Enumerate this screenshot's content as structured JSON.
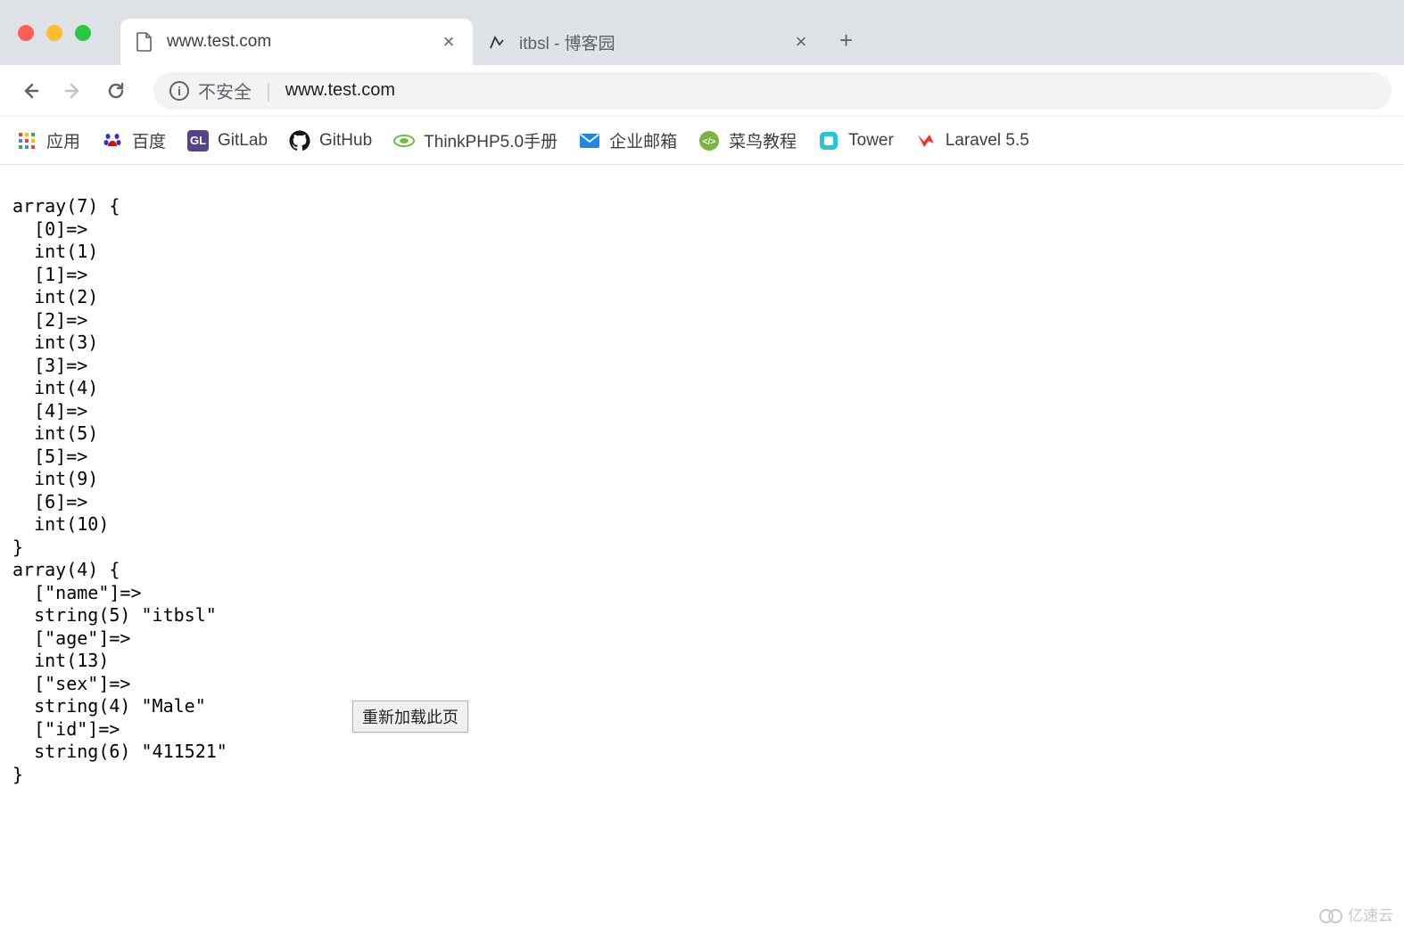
{
  "window": {
    "tabs": [
      {
        "title": "www.test.com",
        "favicon": "file-icon",
        "active": true
      },
      {
        "title": "itbsl - 博客园",
        "favicon": "cnblogs-icon",
        "active": false
      }
    ]
  },
  "toolbar": {
    "security_label": "不安全",
    "url": "www.test.com",
    "reload_tooltip": "重新加载此页"
  },
  "bookmarks": [
    {
      "label": "应用",
      "icon": "apps-icon"
    },
    {
      "label": "百度",
      "icon": "baidu-icon"
    },
    {
      "label": "GitLab",
      "icon": "gitlab-icon"
    },
    {
      "label": "GitHub",
      "icon": "github-icon"
    },
    {
      "label": "ThinkPHP5.0手册",
      "icon": "thinkphp-icon"
    },
    {
      "label": "企业邮箱",
      "icon": "mail-icon"
    },
    {
      "label": "菜鸟教程",
      "icon": "runoob-icon"
    },
    {
      "label": "Tower",
      "icon": "tower-icon"
    },
    {
      "label": "Laravel 5.5",
      "icon": "laravel-icon"
    }
  ],
  "page": {
    "lines": [
      "array(7) {",
      "  [0]=>",
      "  int(1)",
      "  [1]=>",
      "  int(2)",
      "  [2]=>",
      "  int(3)",
      "  [3]=>",
      "  int(4)",
      "  [4]=>",
      "  int(5)",
      "  [5]=>",
      "  int(9)",
      "  [6]=>",
      "  int(10)",
      "}",
      "array(4) {",
      "  [\"name\"]=>",
      "  string(5) \"itbsl\"",
      "  [\"age\"]=>",
      "  int(13)",
      "  [\"sex\"]=>",
      "  string(4) \"Male\"",
      "  [\"id\"]=>",
      "  string(6) \"411521\"",
      "}"
    ]
  },
  "watermark": "亿速云"
}
